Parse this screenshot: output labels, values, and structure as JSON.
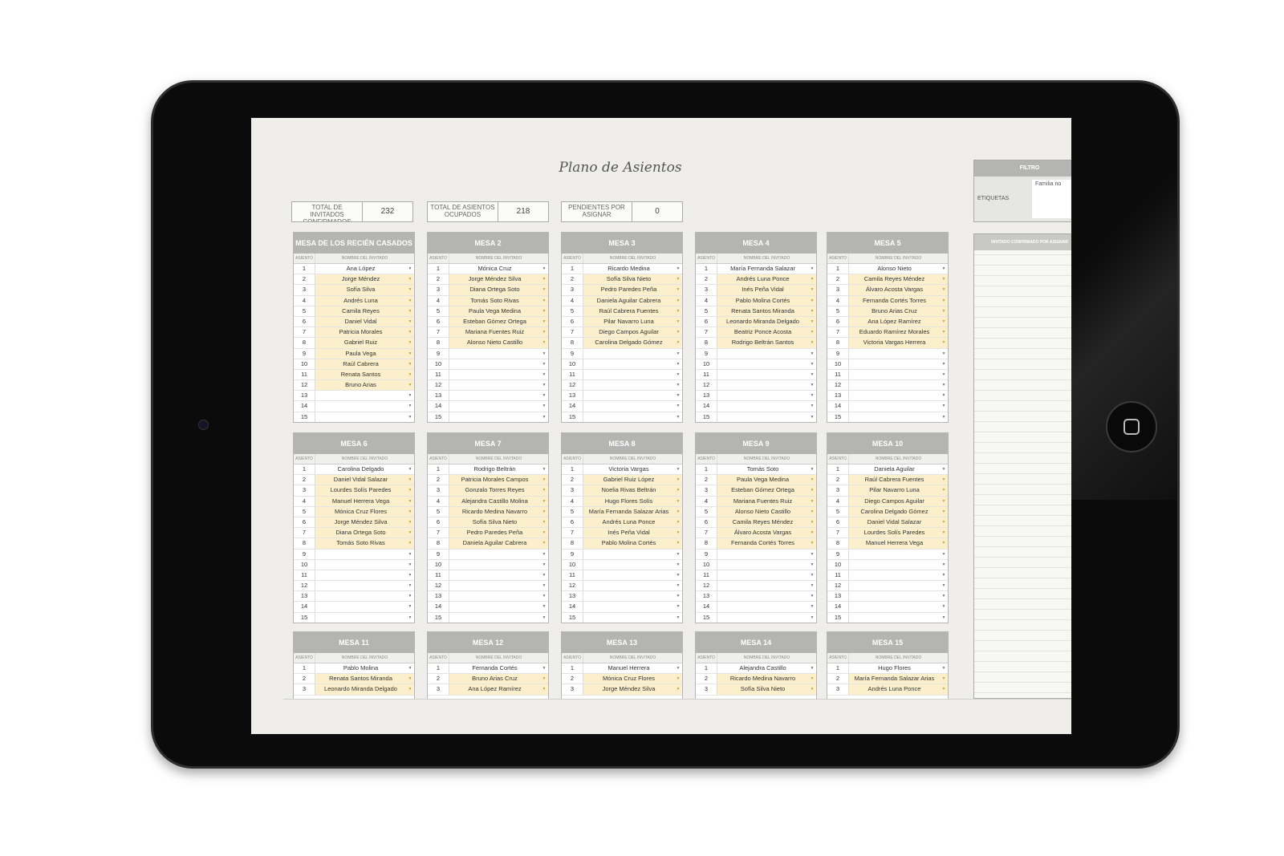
{
  "page_title": "Plano de Asientos",
  "summary": [
    {
      "label": "TOTAL DE INVITADOS CONFIRMADOS",
      "value": "232"
    },
    {
      "label": "TOTAL DE ASIENTOS OCUPADOS",
      "value": "218"
    },
    {
      "label": "PENDIENTES POR ASIGNAR",
      "value": "0"
    }
  ],
  "filter": {
    "header": "FILTRO",
    "label": "ETIQUETAS",
    "value": "Familia no"
  },
  "unassigned_header": "INVITADO CONFIRMADO POR ASIGNAR",
  "col_seat": "ASIENTO",
  "col_name": "NOMBRE DEL INVITADO",
  "dropdown_icon": "▼",
  "tables": [
    {
      "title": "MESA DE LOS RECIÉN CASADOS",
      "guests": [
        "Ana López",
        "Jorge Méndez",
        "Sofía Silva",
        "Andrés Luna",
        "Camila Reyes",
        "Daniel Vidal",
        "Patricia Morales",
        "Gabriel Ruiz",
        "Paula Vega",
        "Raúl Cabrera",
        "Renata Santos",
        "Bruno Arias",
        "",
        "",
        ""
      ]
    },
    {
      "title": "MESA 2",
      "guests": [
        "Mónica Cruz",
        "Jorge Méndez Silva",
        "Diana Ortega Soto",
        "Tomás Soto Rivas",
        "Paula Vega Medina",
        "Esteban Gómez Ortega",
        "Mariana Fuentes Ruiz",
        "Alonso Nieto Castillo",
        "",
        "",
        "",
        "",
        "",
        "",
        ""
      ]
    },
    {
      "title": "MESA 3",
      "guests": [
        "Ricardo Medina",
        "Sofía Silva Nieto",
        "Pedro Paredes Peña",
        "Daniela Aguilar Cabrera",
        "Raúl Cabrera Fuentes",
        "Pilar Navarro Luna",
        "Diego Campos Aguilar",
        "Carolina Delgado Gómez",
        "",
        "",
        "",
        "",
        "",
        "",
        ""
      ]
    },
    {
      "title": "MESA 4",
      "guests": [
        "María Fernanda Salazar",
        "Andrés Luna Ponce",
        "Inés Peña Vidal",
        "Pablo Molina Cortés",
        "Renata Santos Miranda",
        "Leonardo Miranda Delgado",
        "Beatriz Ponce Acosta",
        "Rodrigo Beltrán Santos",
        "",
        "",
        "",
        "",
        "",
        "",
        ""
      ]
    },
    {
      "title": "MESA 5",
      "guests": [
        "Alonso Nieto",
        "Camila Reyes Méndez",
        "Álvaro Acosta Vargas",
        "Fernanda Cortés Torres",
        "Bruno Arias Cruz",
        "Ana López Ramírez",
        "Eduardo Ramírez Morales",
        "Victoria Vargas Herrera",
        "",
        "",
        "",
        "",
        "",
        "",
        ""
      ]
    },
    {
      "title": "MESA 6",
      "guests": [
        "Carolina Delgado",
        "Daniel Vidal Salazar",
        "Lourdes Solís Paredes",
        "Manuel Herrera Vega",
        "Mónica Cruz Flores",
        "Jorge Méndez Silva",
        "Diana Ortega Soto",
        "Tomás Soto Rivas",
        "",
        "",
        "",
        "",
        "",
        "",
        ""
      ]
    },
    {
      "title": "MESA 7",
      "guests": [
        "Rodrigo Beltrán",
        "Patricia Morales Campos",
        "Gonzalo Torres Reyes",
        "Alejandra Castillo Molina",
        "Ricardo Medina Navarro",
        "Sofía Silva Nieto",
        "Pedro Paredes Peña",
        "Daniela Aguilar Cabrera",
        "",
        "",
        "",
        "",
        "",
        "",
        ""
      ]
    },
    {
      "title": "MESA 8",
      "guests": [
        "Victoria Vargas",
        "Gabriel Ruiz López",
        "Noelia Rivas Beltrán",
        "Hugo Flores Solís",
        "María Fernanda Salazar Arias",
        "Andrés Luna Ponce",
        "Inés Peña Vidal",
        "Pablo Molina Cortés",
        "",
        "",
        "",
        "",
        "",
        "",
        ""
      ]
    },
    {
      "title": "MESA 9",
      "guests": [
        "Tomás Soto",
        "Paula Vega Medina",
        "Esteban Gómez Ortega",
        "Mariana Fuentes Ruiz",
        "Alonso Nieto Castillo",
        "Camila Reyes Méndez",
        "Álvaro Acosta Vargas",
        "Fernanda Cortés Torres",
        "",
        "",
        "",
        "",
        "",
        "",
        ""
      ]
    },
    {
      "title": "MESA 10",
      "guests": [
        "Daniela Aguilar",
        "Raúl Cabrera Fuentes",
        "Pilar Navarro Luna",
        "Diego Campos Aguilar",
        "Carolina Delgado Gómez",
        "Daniel Vidal Salazar",
        "Lourdes Solís Paredes",
        "Manuel Herrera Vega",
        "",
        "",
        "",
        "",
        "",
        "",
        ""
      ]
    },
    {
      "title": "MESA 11",
      "guests": [
        "Pablo Molina",
        "Renata Santos Miranda",
        "Leonardo Miranda Delgado"
      ]
    },
    {
      "title": "MESA 12",
      "guests": [
        "Fernanda Cortés",
        "Bruno Arias Cruz",
        "Ana López Ramírez"
      ]
    },
    {
      "title": "MESA 13",
      "guests": [
        "Manuel Herrera",
        "Mónica Cruz Flores",
        "Jorge Méndez Silva"
      ]
    },
    {
      "title": "MESA 14",
      "guests": [
        "Alejandra Castillo",
        "Ricardo Medina Navarro",
        "Sofía Silva Nieto"
      ]
    },
    {
      "title": "MESA 15",
      "guests": [
        "Hugo Flores",
        "María Fernanda Salazar Arias",
        "Andrés Luna Ponce"
      ]
    }
  ]
}
